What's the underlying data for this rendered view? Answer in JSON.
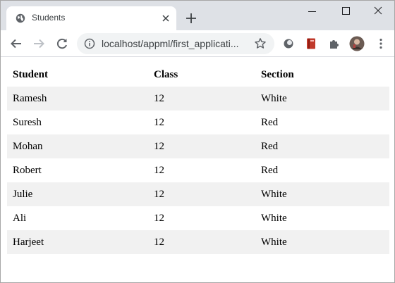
{
  "browser": {
    "tab_title": "Students",
    "url": "localhost/appml/first_applicati...",
    "icons": [
      "globe-icon",
      "close-icon",
      "plus-icon",
      "minimize-icon",
      "maximize-icon",
      "window-close-icon",
      "back-icon",
      "forward-icon",
      "reload-icon",
      "info-icon",
      "star-icon",
      "extension-circle-icon",
      "bookmark-red-icon",
      "puzzle-icon",
      "avatar",
      "menu-dots-icon"
    ]
  },
  "table": {
    "headers": [
      "Student",
      "Class",
      "Section"
    ],
    "rows": [
      [
        "Ramesh",
        "12",
        "White"
      ],
      [
        "Suresh",
        "12",
        "Red"
      ],
      [
        "Mohan",
        "12",
        "Red"
      ],
      [
        "Robert",
        "12",
        "Red"
      ],
      [
        "Julie",
        "12",
        "White"
      ],
      [
        "Ali",
        "12",
        "White"
      ],
      [
        "Harjeet",
        "12",
        "White"
      ]
    ]
  }
}
